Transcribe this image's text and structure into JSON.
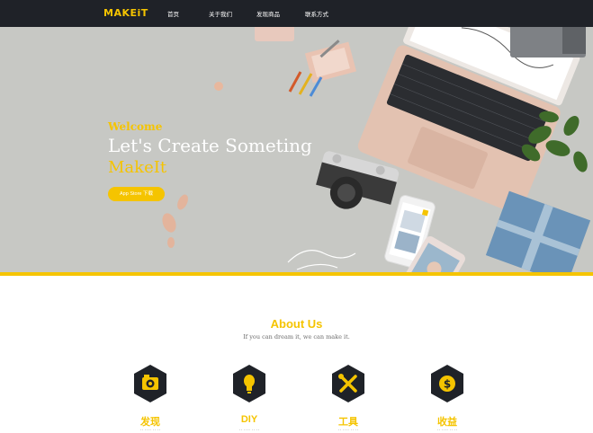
{
  "nav": {
    "logo": "MAKEiT",
    "items": [
      {
        "label": "首页"
      },
      {
        "label": "关于我们"
      },
      {
        "label": "发现商品"
      },
      {
        "label": "联系方式"
      }
    ]
  },
  "hero": {
    "welcome": "Welcome",
    "headline": "Let's Create Someting",
    "brand": "MakeIt",
    "cta_label": "App Store 下载"
  },
  "about": {
    "title": "About Us",
    "subtitle": "If you can dream it, we can make it.",
    "features": [
      {
        "label": "发现",
        "icon": "eye-icon",
        "desc": "·· ···· ·· ··"
      },
      {
        "label": "DIY",
        "icon": "lightbulb-icon",
        "desc": "·· ···· ·· ··"
      },
      {
        "label": "工具",
        "icon": "tools-icon",
        "desc": "·· ···· ·· ··"
      },
      {
        "label": "收益",
        "icon": "dollar-icon",
        "desc": "·· ···· ·· ··"
      }
    ]
  },
  "colors": {
    "accent": "#f5c400",
    "nav_bg": "#1f2228",
    "hero_bg": "#c7c8c4",
    "hex_bg": "#1f2228"
  }
}
